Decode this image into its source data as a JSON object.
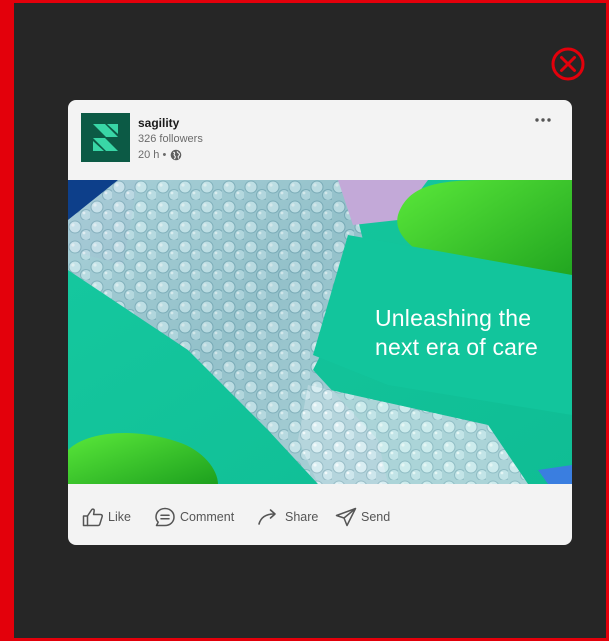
{
  "post": {
    "company_name": "sagility",
    "followers": "326 followers",
    "time": "20 h •",
    "headline_line1": "Unleashing the",
    "headline_line2": "next era of care"
  },
  "actions": {
    "like": "Like",
    "comment": "Comment",
    "share": "Share",
    "send": "Send"
  },
  "icons": {
    "close": "close-icon",
    "logo": "sagility-logo",
    "globe": "globe-icon",
    "more": "more-options-icon",
    "like": "thumbs-up-icon",
    "comment": "comment-icon",
    "share": "share-arrow-icon",
    "send": "send-icon"
  },
  "colors": {
    "frame_border": "#e3000b",
    "background": "#262626",
    "card": "#f3f3f3",
    "brand_green": "#0c5a45",
    "teal": "#10c39a",
    "action_text": "#555555"
  }
}
